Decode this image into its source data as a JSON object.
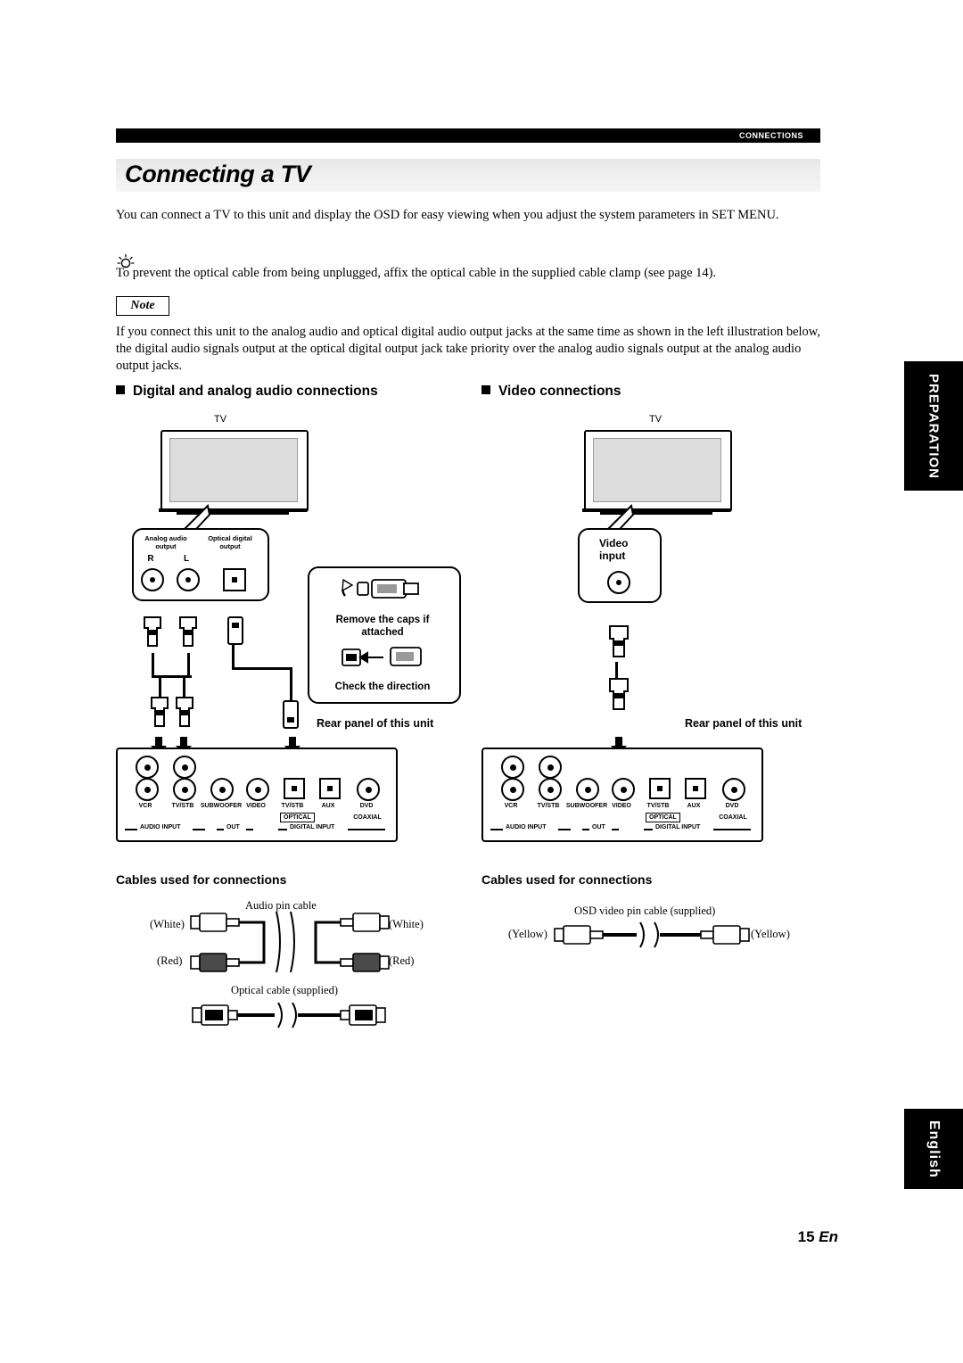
{
  "header": {
    "section_tab": "CONNECTIONS",
    "title": "Connecting a TV"
  },
  "intro": "You can connect a TV to this unit and display the OSD for easy viewing when you adjust the system parameters in SET MENU.",
  "tip": "To prevent the optical cable from being unplugged, affix the optical cable in the supplied cable clamp (see page 14).",
  "note": {
    "label": "Note",
    "text": "If you connect this unit to the analog audio and optical digital audio output jacks at the same time as shown in the left illustration below, the digital audio signals output at the optical digital output jack take priority over the analog audio signals output at the analog audio output jacks."
  },
  "left_section": {
    "heading": "Digital and analog audio connections",
    "tv_label": "TV",
    "bubble": {
      "analog_label": "Analog audio\noutput",
      "analog_line1": "Analog audio",
      "analog_line2": "output",
      "optical_line1": "Optical digital",
      "optical_line2": "output",
      "jack_r": "R",
      "jack_l": "L"
    },
    "callout": {
      "line1": "Remove the caps if",
      "line2": "attached",
      "line3": "Check the direction"
    },
    "rear_panel_label": "Rear panel of this unit",
    "panel": {
      "jack_labels": [
        "VCR",
        "TV/STB",
        "SUBWOOFER",
        "VIDEO",
        "TV/STB",
        "AUX",
        "DVD"
      ],
      "optical_label": "OPTICAL",
      "coaxial_label": "COAXIAL",
      "group_audio_input": "AUDIO INPUT",
      "group_out": "OUT",
      "group_digital_input": "DIGITAL INPUT"
    },
    "cables": {
      "heading": "Cables used for connections",
      "audio_pin_cable": "Audio pin cable",
      "white_left": "(White)",
      "white_right": "(White)",
      "red_left": "(Red)",
      "red_right": "(Red)",
      "optical_cable": "Optical cable (supplied)"
    }
  },
  "right_section": {
    "heading": "Video connections",
    "tv_label": "TV",
    "bubble": {
      "line1": "Video",
      "line2": "input"
    },
    "rear_panel_label": "Rear panel of this unit",
    "panel": {
      "jack_labels": [
        "VCR",
        "TV/STB",
        "SUBWOOFER",
        "VIDEO",
        "TV/STB",
        "AUX",
        "DVD"
      ],
      "optical_label": "OPTICAL",
      "coaxial_label": "COAXIAL",
      "group_audio_input": "AUDIO INPUT",
      "group_out": "OUT",
      "group_digital_input": "DIGITAL INPUT"
    },
    "cables": {
      "heading": "Cables used for connections",
      "osd_cable": "OSD video pin cable (supplied)",
      "yellow_left": "(Yellow)",
      "yellow_right": "(Yellow)"
    }
  },
  "side_tabs": {
    "preparation": "PREPARATION",
    "english": "English"
  },
  "footer": {
    "page_number": "15",
    "page_suffix": "En"
  }
}
